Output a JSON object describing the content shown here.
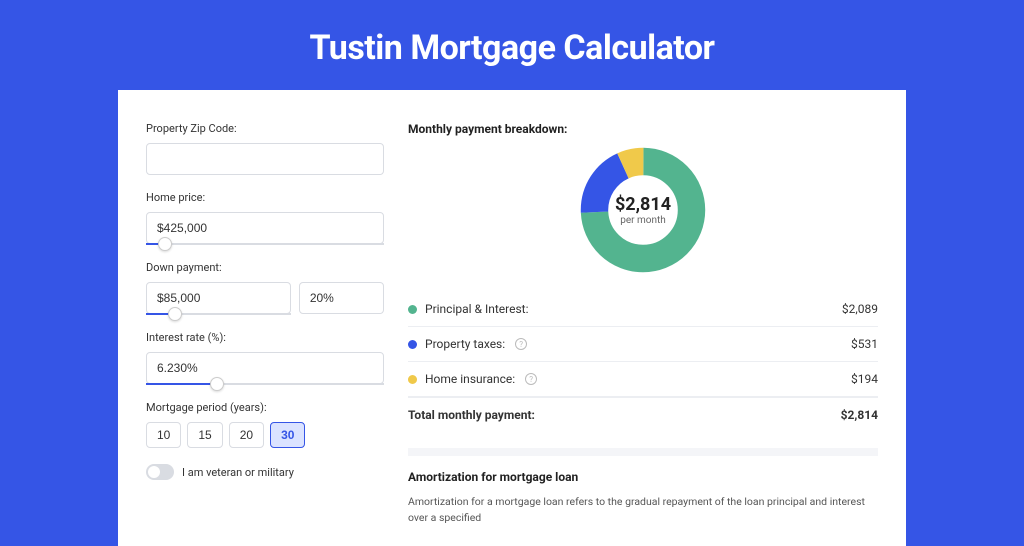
{
  "title": "Tustin Mortgage Calculator",
  "form": {
    "zip": {
      "label": "Property Zip Code:",
      "value": ""
    },
    "price": {
      "label": "Home price:",
      "value": "$425,000",
      "slider_pct": 8
    },
    "down": {
      "label": "Down payment:",
      "amount": "$85,000",
      "pct": "20%",
      "slider_pct": 20
    },
    "rate": {
      "label": "Interest rate (%):",
      "value": "6.230%",
      "slider_pct": 30
    },
    "period": {
      "label": "Mortgage period (years):",
      "options": [
        "10",
        "15",
        "20",
        "30"
      ],
      "selected": "30"
    },
    "veteran": {
      "label": "I am veteran or military",
      "on": false
    }
  },
  "breakdown": {
    "heading": "Monthly payment breakdown:",
    "center_amount": "$2,814",
    "center_sub": "per month",
    "items": [
      {
        "label": "Principal & Interest:",
        "value": "$2,089",
        "color": "#53b48f",
        "help": false,
        "slice": 74.2
      },
      {
        "label": "Property taxes:",
        "value": "$531",
        "color": "#3555e6",
        "help": true,
        "slice": 18.9
      },
      {
        "label": "Home insurance:",
        "value": "$194",
        "color": "#f0c94a",
        "help": true,
        "slice": 6.9
      }
    ],
    "total": {
      "label": "Total monthly payment:",
      "value": "$2,814"
    }
  },
  "amort": {
    "heading": "Amortization for mortgage loan",
    "text": "Amortization for a mortgage loan refers to the gradual repayment of the loan principal and interest over a specified"
  },
  "chart_data": {
    "type": "pie",
    "title": "Monthly payment breakdown",
    "categories": [
      "Principal & Interest",
      "Property taxes",
      "Home insurance"
    ],
    "values": [
      2089,
      531,
      194
    ],
    "colors": [
      "#53b48f",
      "#3555e6",
      "#f0c94a"
    ],
    "center_label": "$2,814 per month"
  }
}
